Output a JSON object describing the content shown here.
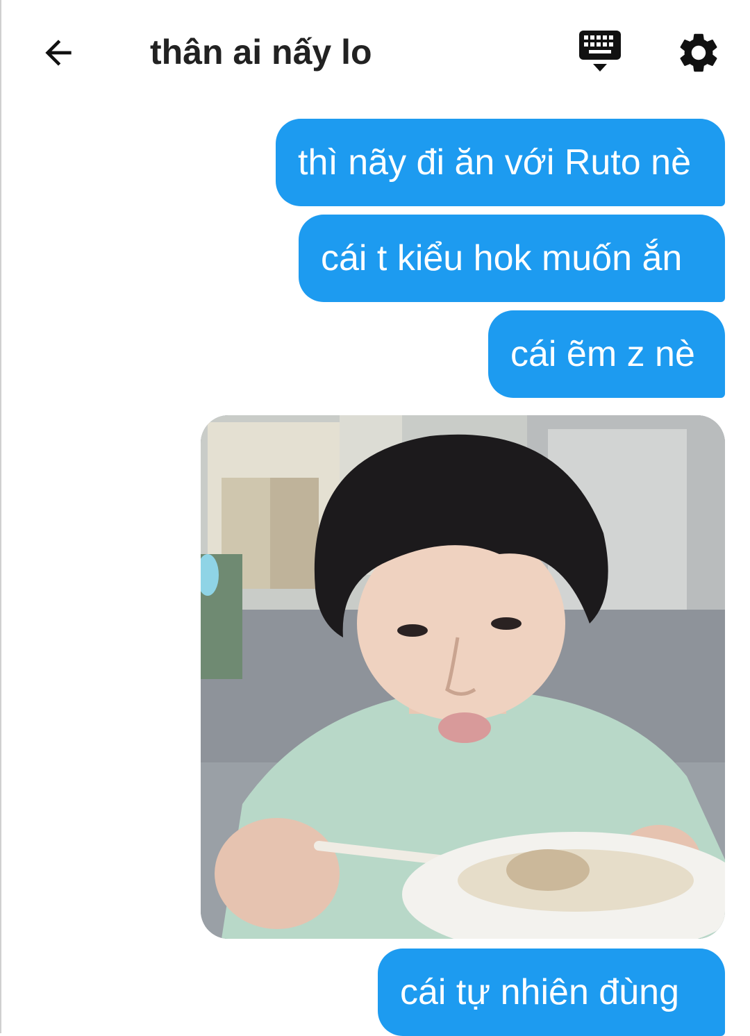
{
  "header": {
    "title": "thân ai nấy lo",
    "back_icon": "arrow-left-icon",
    "keyboard_icon": "keyboard-hide-icon",
    "settings_icon": "gear-icon"
  },
  "messages": [
    {
      "text": "thì nãy đi ăn với Ruto nè"
    },
    {
      "text": "cái t kiểu hok muốn ắn"
    },
    {
      "text": "cái ẽm z nè"
    },
    {
      "type": "image"
    },
    {
      "text": "cái tự nhiên đùng"
    }
  ],
  "colors": {
    "bubble": "#1d9bf0",
    "bubble_text": "#ffffff",
    "title": "#222222",
    "icon": "#111111"
  }
}
